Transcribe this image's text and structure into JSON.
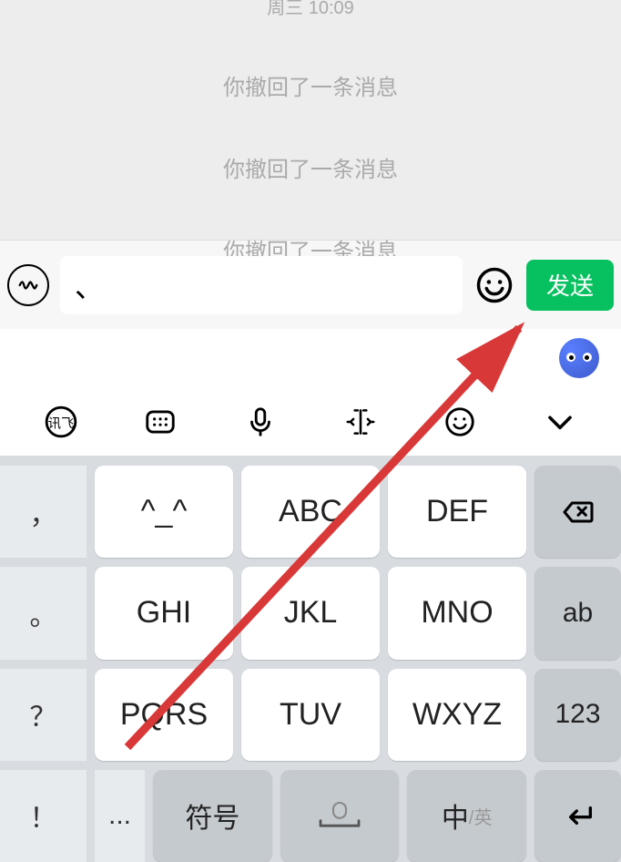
{
  "chat": {
    "timestamp": "周三 10:09",
    "recall_messages": [
      "你撤回了一条消息",
      "你撤回了一条消息",
      "你撤回了一条消息"
    ]
  },
  "input": {
    "text": "、",
    "send_label": "发送"
  },
  "keyboard": {
    "left_col": [
      "，",
      "。",
      "？",
      "！"
    ],
    "row1": [
      "^_^",
      "ABC",
      "DEF"
    ],
    "row2": [
      "GHI",
      "JKL",
      "MNO"
    ],
    "row3": [
      "PQRS",
      "TUV",
      "WXYZ"
    ],
    "right_col": [
      "⌫",
      "ab",
      "123"
    ],
    "bottom": {
      "left": "...",
      "symbol": "符号",
      "lang_main": "中",
      "lang_sub": "/英"
    }
  }
}
